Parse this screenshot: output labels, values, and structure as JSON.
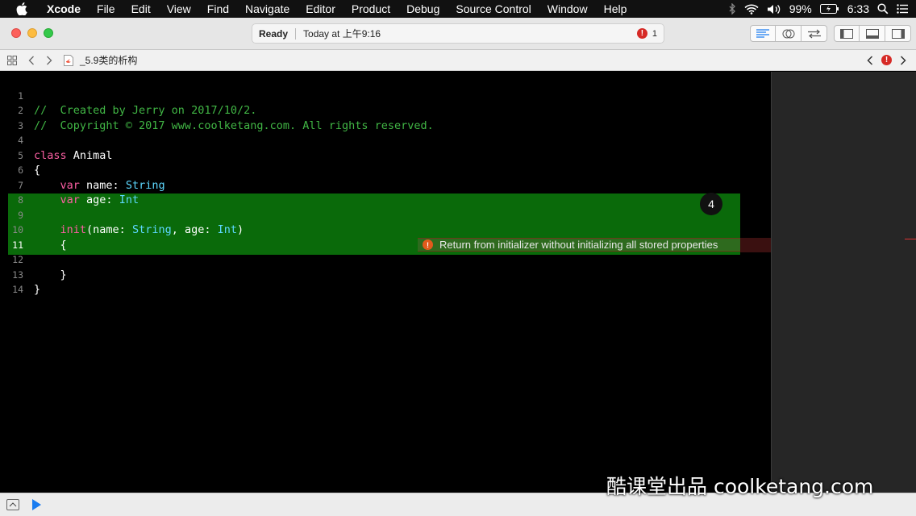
{
  "menubar": {
    "app_name": "Xcode",
    "items": [
      "File",
      "Edit",
      "View",
      "Find",
      "Navigate",
      "Editor",
      "Product",
      "Debug",
      "Source Control",
      "Window",
      "Help"
    ],
    "battery": "99%",
    "time": "6:33"
  },
  "toolbar": {
    "status": "Ready",
    "timestamp": "Today at 上午9:16",
    "error_count": "1"
  },
  "jumpbar": {
    "file_name": "_5.9类的析构"
  },
  "editor": {
    "lines": [
      {
        "n": "1",
        "text": "//  Created by Jerry on 2017/10/2."
      },
      {
        "n": "2",
        "text": "//  Copyright © 2017 www.coolketang.com. All rights reserved."
      },
      {
        "n": "3",
        "text": ""
      },
      {
        "n": "4",
        "text": "class Animal"
      },
      {
        "n": "5",
        "text": "{"
      },
      {
        "n": "6",
        "text": "    var name: String"
      },
      {
        "n": "7",
        "text": "    var age: Int"
      },
      {
        "n": "8",
        "text": ""
      },
      {
        "n": "9",
        "text": "    init(name: String, age: Int)"
      },
      {
        "n": "10",
        "text": "    {"
      },
      {
        "n": "11",
        "text": ""
      },
      {
        "n": "12",
        "text": "    }"
      },
      {
        "n": "13",
        "text": "}"
      },
      {
        "n": "14",
        "text": ""
      }
    ],
    "error_message": "Return from initializer without initializing all stored properties",
    "step_badge": "4"
  },
  "watermark": "酷课堂出品 coolketang.com",
  "colors": {
    "comment": "#41b645",
    "keyword": "#fc5fa3",
    "type": "#5dd8ff",
    "highlight": "#0a6a0a",
    "error_icon": "#e25a1c"
  }
}
